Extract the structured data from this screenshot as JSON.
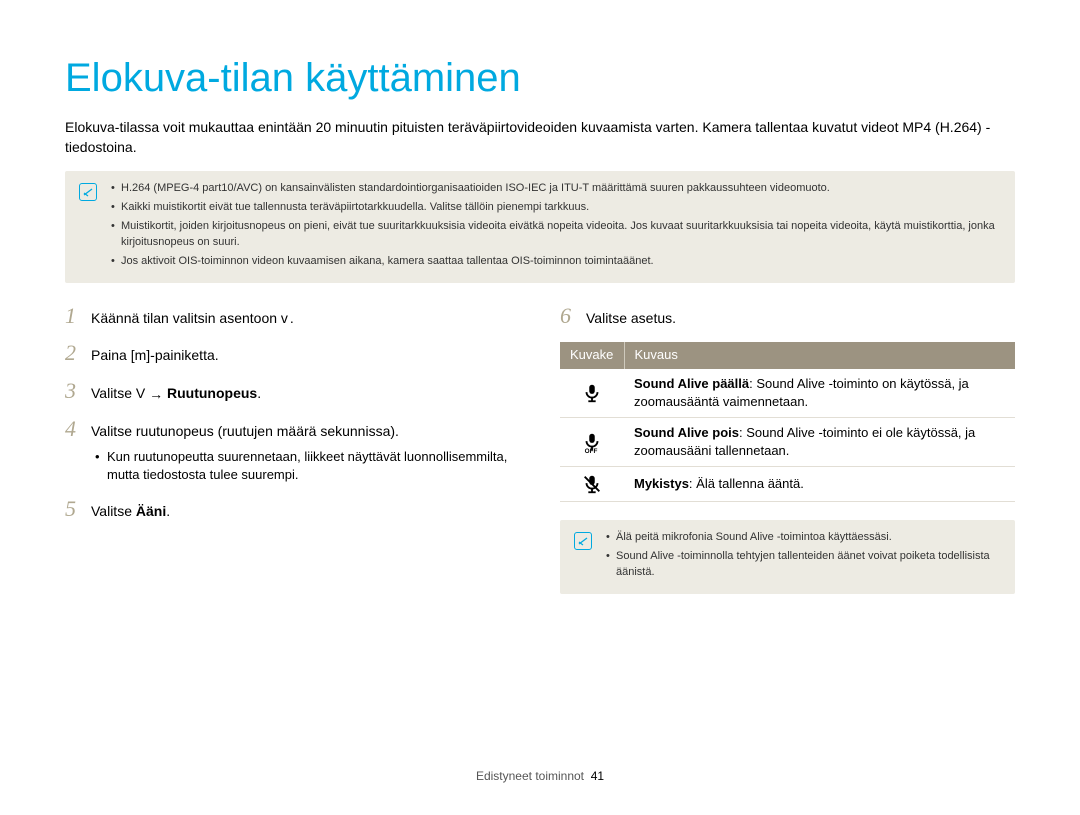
{
  "title": "Elokuva-tilan käyttäminen",
  "intro": "Elokuva-tilassa voit mukauttaa enintään 20 minuutin pituisten teräväpiirtovideoiden kuvaamista varten. Kamera tallentaa kuvatut videot MP4 (H.264) -tiedostoina.",
  "note1": {
    "items": [
      "H.264 (MPEG-4 part10/AVC) on kansainvälisten standardointiorganisaatioiden ISO-IEC ja ITU-T määrittämä suuren pakkaussuhteen videomuoto.",
      "Kaikki muistikortit eivät tue tallennusta teräväpiirtotarkkuudella. Valitse tällöin pienempi tarkkuus.",
      "Muistikortit, joiden kirjoitusnopeus on pieni, eivät tue suuritarkkuuksisia videoita eivätkä nopeita videoita. Jos kuvaat suuritarkkuuksisia tai nopeita videoita, käytä muistikorttia, jonka kirjoitusnopeus on suuri.",
      "Jos aktivoit OIS-toiminnon videon kuvaamisen aikana, kamera saattaa tallentaa OIS-toiminnon toimintaäänet."
    ]
  },
  "steps_left": [
    {
      "n": "1",
      "pre": "Käännä tilan valitsin asentoon ",
      "sym": "v",
      "post": "."
    },
    {
      "n": "2",
      "pre": "Paina [",
      "sym": "m",
      "post": "]-painiketta."
    },
    {
      "n": "3",
      "pre": "Valitse ",
      "sym": "V",
      "arrow": true,
      "bold": "Ruutunopeus",
      "post": "."
    },
    {
      "n": "4",
      "pre": "Valitse ruutunopeus (ruutujen määrä sekunnissa).",
      "sub": "Kun ruutunopeutta suurennetaan, liikkeet näyttävät luonnollisemmilta, mutta tiedostosta tulee suurempi."
    },
    {
      "n": "5",
      "pre": "Valitse ",
      "bold": "Ääni",
      "post": "."
    }
  ],
  "step6": {
    "n": "6",
    "text": "Valitse asetus."
  },
  "table": {
    "head": {
      "c1": "Kuvake",
      "c2": "Kuvaus"
    },
    "rows": [
      {
        "icon": "mic-on",
        "b": "Sound Alive päällä",
        "t": ": Sound Alive -toiminto on käytössä, ja zoomausääntä vaimennetaan."
      },
      {
        "icon": "mic-off",
        "b": "Sound Alive pois",
        "t": ": Sound Alive -toiminto ei ole käytössä, ja zoomausääni tallennetaan."
      },
      {
        "icon": "mic-mute",
        "b": "Mykistys",
        "t": ": Älä tallenna ääntä."
      }
    ]
  },
  "note2": {
    "items": [
      "Älä peitä mikrofonia Sound Alive -toimintoa käyttäessäsi.",
      "Sound Alive -toiminnolla tehtyjen tallenteiden äänet voivat poiketa todellisista äänistä."
    ]
  },
  "footer": {
    "section": "Edistyneet toiminnot",
    "page": "41"
  }
}
